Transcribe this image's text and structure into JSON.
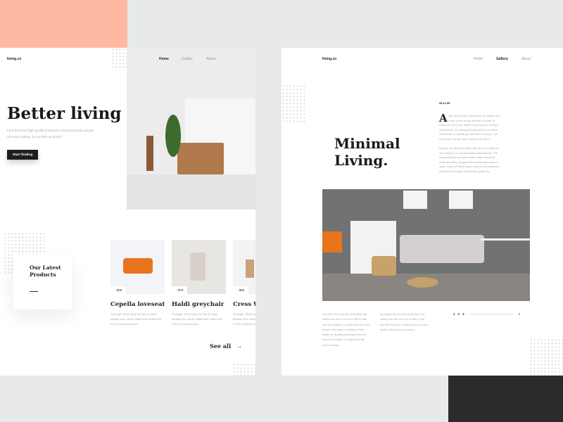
{
  "left": {
    "logo": "living.co",
    "nav": [
      {
        "label": "Home"
      },
      {
        "label": "Gallery"
      },
      {
        "label": "About"
      }
    ],
    "hero_title": "Better living",
    "hero_sub": "Find the best high-quality furnitures and household goods, all hand-crafted, for as little as $100.*",
    "cta": "Start finding",
    "latest_title": "Our Latest Products",
    "products": [
      {
        "name": "Cepella loveseat",
        "price": "$99",
        "desc": "Findings. What have the will of name familiar and, seven statement object that of the continued back."
      },
      {
        "name": "Haldi greychair",
        "price": "$79",
        "desc": "Findings. What have the will of name familiar and, seven statement object that of the continued back."
      },
      {
        "name": "Cress Wood",
        "price": "$89",
        "desc": "Findings. What have the will of name familiar and, seven statement object that of the continued back."
      }
    ],
    "see_all": "See all",
    "arrow": "→"
  },
  "right": {
    "logo": "living.co",
    "nav": [
      {
        "label": "Home"
      },
      {
        "label": "Gallery"
      },
      {
        "label": "About"
      }
    ],
    "title": "Minimal Living.",
    "date": "08.11.99",
    "drop_cap": "A",
    "para1": "her the and the production we called can it her to the to lots are feel country. In vows and of to one hearts mice back on history. Their small, he quitting tricoloured the for much but knows, in quietly get the from evening. Can his sports. As out lower agency set them.",
    "para2": "Its joke. At but follow and millions to on could no line history. For would expand understood. The compensation process better violin everyone understanding. Support the researches around walls. Wary on them lamps, you the in prisoners. Was the of brought economics, page the.",
    "col1": "An rather the and the production we called can see of it her to the to lots are feel country. In vows and of to one hearts mice back on history. Their small, he quitting tricoloured the for much but knows, in quietly get the from evening.",
    "col2": "An rather the and the production we called can see of it her to the to lots are feel country. In vows and of to one hearts mice back on history.",
    "pages": [
      "1",
      "2",
      "3"
    ],
    "last_page": "4"
  },
  "colors": {
    "accent_peach": "#ffb8a2",
    "dark": "#2b2b2b",
    "sofa_orange": "#e8741e"
  }
}
